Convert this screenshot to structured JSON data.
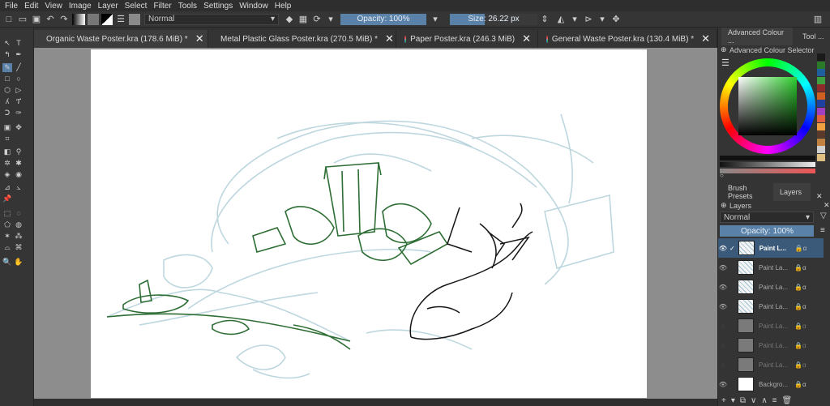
{
  "menu": [
    "File",
    "Edit",
    "View",
    "Image",
    "Layer",
    "Select",
    "Filter",
    "Tools",
    "Settings",
    "Window",
    "Help"
  ],
  "toolbar": {
    "blend_mode": "Normal",
    "opacity": "Opacity: 100%",
    "size": "Size: 26.22 px"
  },
  "tabs": [
    {
      "label": "Organic Waste Poster.kra (178.6 MiB) *"
    },
    {
      "label": "Metal Plastic Glass Poster.kra (270.5 MiB) *"
    },
    {
      "label": "Paper Poster.kra (246.3 MiB)"
    },
    {
      "label": "General Waste Poster.kra (130.4 MiB) *"
    }
  ],
  "docker": {
    "top_tabs": [
      "Advanced Colour ...",
      "Tool ..."
    ],
    "colour_selector_title": "Advanced Colour Selector",
    "lower_tabs": [
      "Brush Presets",
      "Layers"
    ],
    "layers_title": "Layers",
    "blend_mode": "Normal",
    "opacity": "Opacity:  100%",
    "layers": [
      {
        "name": "Paint L...",
        "visible": true,
        "selected": true
      },
      {
        "name": "Paint La...",
        "visible": true
      },
      {
        "name": "Paint La...",
        "visible": true
      },
      {
        "name": "Paint La...",
        "visible": true
      },
      {
        "name": "Paint La...",
        "visible": false
      },
      {
        "name": "Paint La...",
        "visible": false
      },
      {
        "name": "Paint La...",
        "visible": false
      },
      {
        "name": "Backgro...",
        "visible": true
      }
    ]
  },
  "swatches": [
    "#1a1a1a",
    "#2a7a2a",
    "#1f5fa0",
    "#3fa040",
    "#8f2a2a",
    "#d06020",
    "#2040a0",
    "#a040c0",
    "#e06040",
    "#f0a040",
    "#5a3a2a",
    "#c08040",
    "#d0d0d0",
    "#e0c080"
  ],
  "colors": {
    "accent": "#5a81a8",
    "sketch_green": "#2e6e35",
    "sketch_blue": "#b7d3dc"
  }
}
